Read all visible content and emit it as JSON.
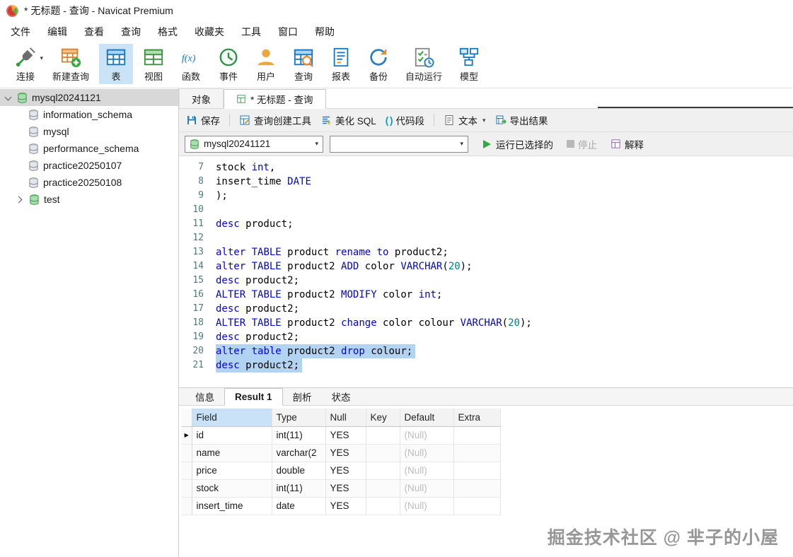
{
  "colors": {
    "accent_blue": "#1b79c0",
    "keyword_blue": "#0000e0",
    "number_teal": "#008080",
    "selection_blue": "#b3d3f2",
    "toolbar_active_bg": "#cbe3f7",
    "sidebar_selected_bg": "#d8d8d8",
    "run_green": "#2faa44",
    "null_gray": "#bdbdbd"
  },
  "titlebar": {
    "title": "* 无标题 - 查询 - Navicat Premium"
  },
  "menubar": {
    "items": [
      {
        "label": "文件",
        "name": "file"
      },
      {
        "label": "编辑",
        "name": "edit"
      },
      {
        "label": "查看",
        "name": "view"
      },
      {
        "label": "查询",
        "name": "query"
      },
      {
        "label": "格式",
        "name": "format"
      },
      {
        "label": "收藏夹",
        "name": "favorites"
      },
      {
        "label": "工具",
        "name": "tools"
      },
      {
        "label": "窗口",
        "name": "window"
      },
      {
        "label": "帮助",
        "name": "help"
      }
    ]
  },
  "toolbar": {
    "items": [
      {
        "label": "连接",
        "icon": "connection-icon",
        "active": false,
        "has_dropdown": true
      },
      {
        "label": "新建查询",
        "icon": "new-query-icon",
        "active": false
      },
      {
        "label": "表",
        "icon": "table-icon",
        "active": true
      },
      {
        "label": "视图",
        "icon": "view-icon",
        "active": false
      },
      {
        "label": "函数",
        "icon": "function-icon",
        "active": false
      },
      {
        "label": "事件",
        "icon": "event-icon",
        "active": false
      },
      {
        "label": "用户",
        "icon": "user-icon",
        "active": false
      },
      {
        "label": "查询",
        "icon": "query-icon",
        "active": false
      },
      {
        "label": "报表",
        "icon": "report-icon",
        "active": false
      },
      {
        "label": "备份",
        "icon": "backup-icon",
        "active": false
      },
      {
        "label": "自动运行",
        "icon": "automation-icon",
        "active": false
      },
      {
        "label": "模型",
        "icon": "model-icon",
        "active": false
      }
    ]
  },
  "sidebar": {
    "root": {
      "label": "mysql20241121",
      "icon": "database-connection-icon",
      "expanded": true,
      "selected": true
    },
    "items": [
      {
        "label": "information_schema",
        "icon": "schema-icon"
      },
      {
        "label": "mysql",
        "icon": "schema-icon"
      },
      {
        "label": "performance_schema",
        "icon": "schema-icon"
      },
      {
        "label": "practice20250107",
        "icon": "schema-icon"
      },
      {
        "label": "practice20250108",
        "icon": "schema-icon"
      },
      {
        "label": "test",
        "icon": "database-connection-icon",
        "collapsed": true
      }
    ]
  },
  "tabbar": {
    "objects_tab": "对象",
    "query_tab": "* 无标题 - 查询"
  },
  "query_toolbar": {
    "save": "保存",
    "builder": "查询创建工具",
    "beautify": "美化 SQL",
    "snippet_glyph": "( )",
    "snippet": "代码段",
    "text": "文本",
    "export": "导出结果"
  },
  "run_bar": {
    "connection_select": "mysql20241121",
    "database_select": "",
    "run": "运行已选择的",
    "stop": "停止",
    "explain": "解释"
  },
  "editor": {
    "lines": [
      {
        "n": 7,
        "sel": false,
        "tokens": [
          {
            "c": "p",
            "t": "stock "
          },
          {
            "c": "k",
            "t": "int"
          },
          {
            "c": "p",
            "t": ","
          }
        ]
      },
      {
        "n": 8,
        "sel": false,
        "tokens": [
          {
            "c": "p",
            "t": "insert_time "
          },
          {
            "c": "k",
            "t": "DATE"
          }
        ]
      },
      {
        "n": 9,
        "sel": false,
        "tokens": [
          {
            "c": "p",
            "t": ");"
          }
        ]
      },
      {
        "n": 10,
        "sel": false,
        "tokens": []
      },
      {
        "n": 11,
        "sel": false,
        "tokens": [
          {
            "c": "k",
            "t": "desc"
          },
          {
            "c": "p",
            "t": " product;"
          }
        ]
      },
      {
        "n": 12,
        "sel": false,
        "tokens": []
      },
      {
        "n": 13,
        "sel": false,
        "tokens": [
          {
            "c": "k",
            "t": "alter"
          },
          {
            "c": "p",
            "t": " "
          },
          {
            "c": "k",
            "t": "TABLE"
          },
          {
            "c": "p",
            "t": " product "
          },
          {
            "c": "k",
            "t": "rename"
          },
          {
            "c": "p",
            "t": " "
          },
          {
            "c": "k",
            "t": "to"
          },
          {
            "c": "p",
            "t": " product2;"
          }
        ]
      },
      {
        "n": 14,
        "sel": false,
        "tokens": [
          {
            "c": "k",
            "t": "alter"
          },
          {
            "c": "p",
            "t": " "
          },
          {
            "c": "k",
            "t": "TABLE"
          },
          {
            "c": "p",
            "t": " product2 "
          },
          {
            "c": "k",
            "t": "ADD"
          },
          {
            "c": "p",
            "t": " color "
          },
          {
            "c": "k",
            "t": "VARCHAR"
          },
          {
            "c": "p",
            "t": "("
          },
          {
            "c": "n",
            "t": "20"
          },
          {
            "c": "p",
            "t": ");"
          }
        ]
      },
      {
        "n": 15,
        "sel": false,
        "tokens": [
          {
            "c": "k",
            "t": "desc"
          },
          {
            "c": "p",
            "t": " product2;"
          }
        ]
      },
      {
        "n": 16,
        "sel": false,
        "tokens": [
          {
            "c": "k",
            "t": "ALTER"
          },
          {
            "c": "p",
            "t": " "
          },
          {
            "c": "k",
            "t": "TABLE"
          },
          {
            "c": "p",
            "t": " product2 "
          },
          {
            "c": "k",
            "t": "MODIFY"
          },
          {
            "c": "p",
            "t": " color "
          },
          {
            "c": "k",
            "t": "int"
          },
          {
            "c": "p",
            "t": ";"
          }
        ]
      },
      {
        "n": 17,
        "sel": false,
        "tokens": [
          {
            "c": "k",
            "t": "desc"
          },
          {
            "c": "p",
            "t": " product2;"
          }
        ]
      },
      {
        "n": 18,
        "sel": false,
        "tokens": [
          {
            "c": "k",
            "t": "ALTER"
          },
          {
            "c": "p",
            "t": " "
          },
          {
            "c": "k",
            "t": "TABLE"
          },
          {
            "c": "p",
            "t": " product2 "
          },
          {
            "c": "k",
            "t": "change"
          },
          {
            "c": "p",
            "t": " color colour "
          },
          {
            "c": "k",
            "t": "VARCHAR"
          },
          {
            "c": "p",
            "t": "("
          },
          {
            "c": "n",
            "t": "20"
          },
          {
            "c": "p",
            "t": ");"
          }
        ]
      },
      {
        "n": 19,
        "sel": false,
        "tokens": [
          {
            "c": "k",
            "t": "desc"
          },
          {
            "c": "p",
            "t": " product2;"
          }
        ]
      },
      {
        "n": 20,
        "sel": true,
        "tokens": [
          {
            "c": "k",
            "t": "alter"
          },
          {
            "c": "p",
            "t": " "
          },
          {
            "c": "k",
            "t": "table"
          },
          {
            "c": "p",
            "t": " product2 "
          },
          {
            "c": "k",
            "t": "drop"
          },
          {
            "c": "p",
            "t": " colour;"
          }
        ]
      },
      {
        "n": 21,
        "sel": true,
        "tokens": [
          {
            "c": "k",
            "t": "desc"
          },
          {
            "c": "p",
            "t": " product2;"
          }
        ]
      }
    ]
  },
  "result_panel": {
    "tabs": [
      {
        "label": "信息",
        "name": "info",
        "active": false
      },
      {
        "label": "Result 1",
        "name": "result-1",
        "active": true
      },
      {
        "label": "剖析",
        "name": "profile",
        "active": false
      },
      {
        "label": "状态",
        "name": "status",
        "active": false
      }
    ],
    "grid": {
      "columns": [
        "Field",
        "Type",
        "Null",
        "Key",
        "Default",
        "Extra"
      ],
      "rows": [
        {
          "current": true,
          "cells": [
            "id",
            "int(11)",
            "YES",
            "",
            "(Null)",
            ""
          ]
        },
        {
          "current": false,
          "cells": [
            "name",
            "varchar(2",
            "YES",
            "",
            "(Null)",
            ""
          ]
        },
        {
          "current": false,
          "cells": [
            "price",
            "double",
            "YES",
            "",
            "(Null)",
            ""
          ]
        },
        {
          "current": false,
          "cells": [
            "stock",
            "int(11)",
            "YES",
            "",
            "(Null)",
            ""
          ]
        },
        {
          "current": false,
          "cells": [
            "insert_time",
            "date",
            "YES",
            "",
            "(Null)",
            ""
          ]
        }
      ]
    }
  },
  "watermark": "掘金技术社区 @ 芈子的小屋"
}
